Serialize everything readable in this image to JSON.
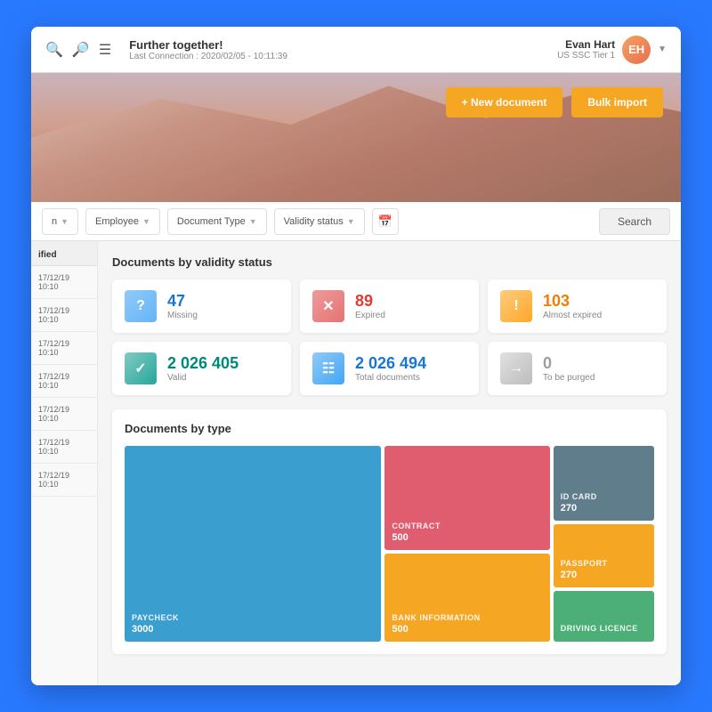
{
  "topbar": {
    "search_icon": "🔍",
    "zoom_icon": "🔎",
    "menu_icon": "☰",
    "title": "Further together!",
    "subtitle": "Last Connection : 2020/02/05 - 10:11:39",
    "user_name": "Evan Hart",
    "user_role": "US SSC Tier 1",
    "user_initials": "EH"
  },
  "hero": {
    "new_doc_label": "+ New document",
    "bulk_import_label": "Bulk import"
  },
  "filters": {
    "filter1_placeholder": "n",
    "employee_label": "Employee",
    "doc_type_label": "Document Type",
    "validity_label": "Validity status",
    "search_label": "Search"
  },
  "validity_section": {
    "title": "Documents by validity status",
    "cards": [
      {
        "id": "missing",
        "number": "47",
        "label": "Missing",
        "icon": "?",
        "color_class": "missing",
        "num_class": "blue"
      },
      {
        "id": "expired",
        "number": "89",
        "label": "Expired",
        "icon": "✕",
        "color_class": "expired",
        "num_class": "red"
      },
      {
        "id": "almost-expired",
        "number": "103",
        "label": "Almost expired",
        "icon": "!",
        "color_class": "almost-expired",
        "num_class": "orange"
      },
      {
        "id": "valid",
        "number": "2 026 405",
        "label": "Valid",
        "icon": "✓",
        "color_class": "valid",
        "num_class": "teal"
      },
      {
        "id": "total",
        "number": "2 026 494",
        "label": "Total documents",
        "icon": "≡",
        "color_class": "total",
        "num_class": "blue"
      },
      {
        "id": "purged",
        "number": "0",
        "label": "To be purged",
        "icon": "→",
        "color_class": "purged",
        "num_class": "gray"
      }
    ]
  },
  "doctype_section": {
    "title": "Documents by type",
    "cells": [
      {
        "id": "paycheck",
        "label": "PAYCHECK",
        "value": "3000",
        "color_class": "cell-paycheck"
      },
      {
        "id": "contract",
        "label": "CONTRACT",
        "value": "500",
        "color_class": "cell-contract"
      },
      {
        "id": "id-card",
        "label": "ID CARD",
        "value": "270",
        "color_class": "cell-id-card"
      },
      {
        "id": "bank-info",
        "label": "BANK INFORMATION",
        "value": "500",
        "color_class": "cell-bank-info"
      },
      {
        "id": "passport",
        "label": "PASSPORT",
        "value": "270",
        "color_class": "cell-passport"
      },
      {
        "id": "driving",
        "label": "DRIVING LICENCE",
        "value": "",
        "color_class": "cell-driving"
      }
    ]
  },
  "sidebar_items": {
    "header": "ified",
    "rows": [
      "17/12/19 10:10",
      "17/12/19 10:10",
      "17/12/19 10:10",
      "17/12/19 10:10",
      "17/12/19 10:10",
      "17/12/19 10:10",
      "17/12/19 10:10"
    ]
  }
}
